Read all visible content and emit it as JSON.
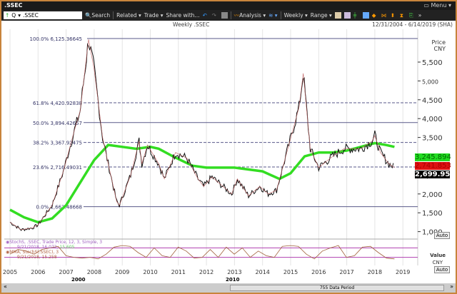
{
  "window": {
    "title": ".SSEC",
    "menu": "Menu"
  },
  "toolbar": {
    "symbol": ".SSEC",
    "q": "Q",
    "search": "Search",
    "related": "Related",
    "trade": "Trade",
    "share": "Share with...",
    "analysis": "Analysis",
    "weekly": "Weekly",
    "range": "Range"
  },
  "header": {
    "title": "Weekly .SSEC",
    "range": "12/31/2004 - 6/14/2019 (SHA)"
  },
  "price_axis": {
    "title": "Price",
    "currency": "CNY",
    "auto": "Auto",
    "ticks": [
      "5,500",
      "5,000",
      "4,500",
      "4,000",
      "3,500",
      "2,500",
      "2,000",
      "1,500",
      "1,000"
    ],
    "tags": [
      {
        "value": "3,245.894",
        "color": "#22dd22"
      },
      {
        "value": "2,741.853",
        "color": "#dd1111"
      },
      {
        "value": "2,699.95",
        "color": "#000000"
      }
    ]
  },
  "stoch": {
    "legend1": "StochS, .SSEC, Trade Price, 12, 3, Simple, 3",
    "legend1_vals": "9/21/2018, 16.072,",
    "legend1_val2": "15.605",
    "legend2": "MMA, StochS(.SSEC), 3",
    "legend2_vals": "9/21/2018, 15.258",
    "axis_title": "Value",
    "currency": "CNY",
    "auto": "Auto"
  },
  "footer": {
    "period": "755 Data Period",
    "decade1": "2000",
    "decade2": "2010"
  },
  "chart_data": {
    "type": "line",
    "title": "Weekly .SSEC",
    "x_ticks": [
      "2005",
      "2006",
      "2007",
      "2008",
      "2009",
      "2010",
      "2011",
      "2012",
      "2013",
      "2014",
      "2015",
      "2016",
      "2017",
      "2018",
      "2019"
    ],
    "ylim": [
      850,
      6400
    ],
    "fib_levels": [
      {
        "label": "100.0%",
        "value": "6,125.36645",
        "v": 6125.36645,
        "dash": false
      },
      {
        "label": "61.8%",
        "value": "4,420.92838",
        "v": 4420.92838,
        "dash": true
      },
      {
        "label": "50.0%",
        "value": "3,894.42657",
        "v": 3894.42657,
        "dash": false
      },
      {
        "label": "38.2%",
        "value": "3,367.92475",
        "v": 3367.92475,
        "dash": true
      },
      {
        "label": "23.6%",
        "value": "2,716.49031",
        "v": 2716.49031,
        "dash": true
      },
      {
        "label": "0.0%",
        "value": "1,663.48668",
        "v": 1663.48668,
        "dash": false
      }
    ],
    "price": [
      [
        2005.0,
        1250
      ],
      [
        2005.4,
        1050
      ],
      [
        2005.8,
        1100
      ],
      [
        2006.0,
        1180
      ],
      [
        2006.5,
        1700
      ],
      [
        2006.9,
        2600
      ],
      [
        2007.3,
        3700
      ],
      [
        2007.5,
        4200
      ],
      [
        2007.8,
        6100
      ],
      [
        2008.0,
        5300
      ],
      [
        2008.3,
        3500
      ],
      [
        2008.5,
        2800
      ],
      [
        2008.8,
        1800
      ],
      [
        2008.9,
        1700
      ],
      [
        2009.3,
        2500
      ],
      [
        2009.6,
        3400
      ],
      [
        2009.7,
        2800
      ],
      [
        2009.9,
        3300
      ],
      [
        2010.3,
        2800
      ],
      [
        2010.5,
        2400
      ],
      [
        2010.9,
        3100
      ],
      [
        2011.3,
        2950
      ],
      [
        2011.7,
        2400
      ],
      [
        2011.9,
        2200
      ],
      [
        2012.2,
        2450
      ],
      [
        2012.9,
        2000
      ],
      [
        2013.1,
        2400
      ],
      [
        2013.5,
        1950
      ],
      [
        2013.9,
        2200
      ],
      [
        2014.2,
        2000
      ],
      [
        2014.5,
        2100
      ],
      [
        2014.9,
        3200
      ],
      [
        2015.3,
        4300
      ],
      [
        2015.45,
        5200
      ],
      [
        2015.7,
        3200
      ],
      [
        2016.0,
        2700
      ],
      [
        2016.5,
        3000
      ],
      [
        2016.9,
        3200
      ],
      [
        2017.5,
        3200
      ],
      [
        2017.9,
        3400
      ],
      [
        2018.0,
        3550
      ],
      [
        2018.2,
        3100
      ],
      [
        2018.5,
        2800
      ],
      [
        2018.7,
        2700
      ]
    ],
    "ma": [
      [
        2005,
        1580
      ],
      [
        2005.5,
        1380
      ],
      [
        2006,
        1250
      ],
      [
        2006.5,
        1350
      ],
      [
        2007,
        1700
      ],
      [
        2007.5,
        2300
      ],
      [
        2008,
        2900
      ],
      [
        2008.5,
        3300
      ],
      [
        2009,
        3250
      ],
      [
        2009.5,
        3200
      ],
      [
        2010,
        3250
      ],
      [
        2010.3,
        3200
      ],
      [
        2010.8,
        3000
      ],
      [
        2011.5,
        2750
      ],
      [
        2012,
        2700
      ],
      [
        2013,
        2700
      ],
      [
        2014,
        2600
      ],
      [
        2014.6,
        2400
      ],
      [
        2015,
        2550
      ],
      [
        2015.5,
        3000
      ],
      [
        2016,
        3100
      ],
      [
        2016.5,
        3100
      ],
      [
        2017,
        3150
      ],
      [
        2017.5,
        3250
      ],
      [
        2018,
        3350
      ],
      [
        2018.4,
        3300
      ],
      [
        2018.7,
        3250
      ]
    ],
    "stoch": [
      40,
      70,
      60,
      40,
      70,
      80,
      90,
      30,
      20,
      15,
      20,
      10,
      40,
      85,
      95,
      90,
      50,
      20,
      80,
      30,
      20,
      85,
      60,
      15,
      20,
      70,
      20,
      85,
      40,
      80,
      20,
      60,
      30,
      20,
      90,
      95,
      90,
      40,
      10,
      60,
      80,
      95,
      20,
      30,
      85,
      90,
      50,
      15,
      10
    ]
  }
}
